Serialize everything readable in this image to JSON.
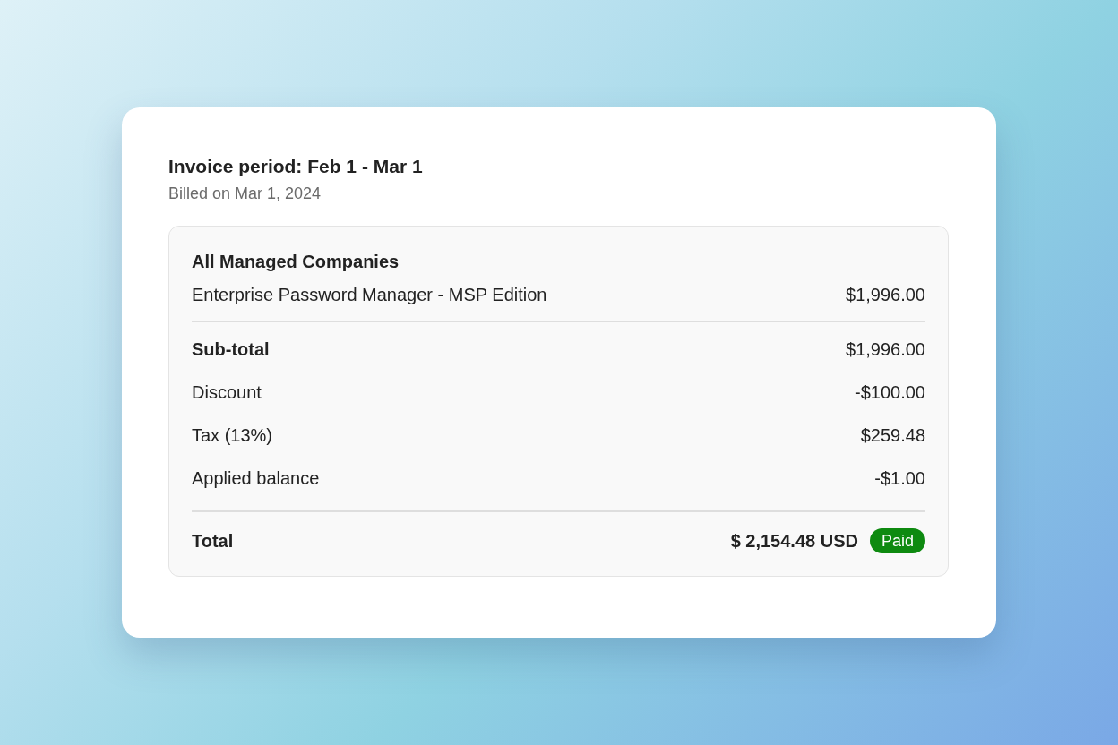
{
  "invoice": {
    "title": "Invoice period: Feb 1 - Mar 1",
    "billed": "Billed on Mar 1, 2024"
  },
  "section": {
    "heading": "All Managed Companies",
    "items": [
      {
        "label": "Enterprise Password Manager - MSP Edition",
        "amount": "$1,996.00"
      }
    ]
  },
  "summary": [
    {
      "label": "Sub-total",
      "amount": "$1,996.00",
      "kind": "subtotal"
    },
    {
      "label": "Discount",
      "amount": "-$100.00",
      "kind": "line"
    },
    {
      "label": "Tax (13%)",
      "amount": "$259.48",
      "kind": "line"
    },
    {
      "label": "Applied balance",
      "amount": "-$1.00",
      "kind": "line"
    }
  ],
  "total": {
    "label": "Total",
    "amount": "$ 2,154.48 USD",
    "status": "Paid"
  }
}
